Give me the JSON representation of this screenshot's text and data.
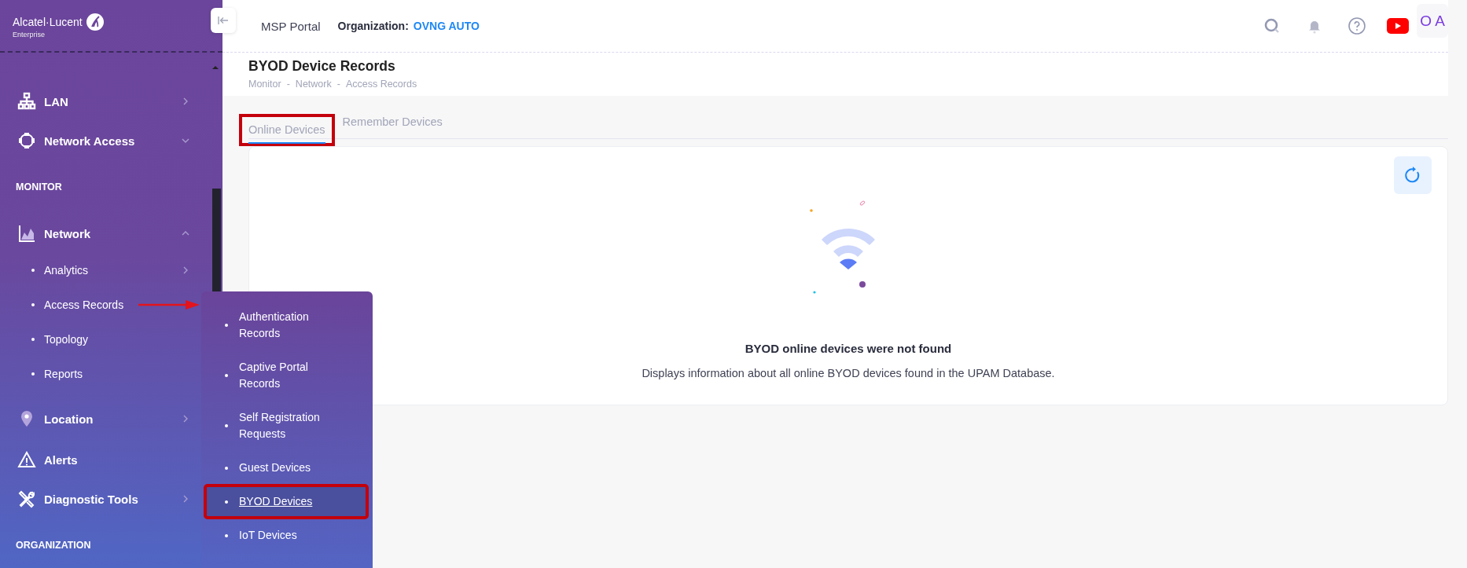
{
  "sidebar": {
    "logo": {
      "name": "Alcatel·Lucent",
      "sub": "Enterprise"
    },
    "items": [
      {
        "kind": "item",
        "label": "LAN",
        "has_submenu": true
      },
      {
        "kind": "item",
        "label": "Network Access",
        "expanded": false
      },
      {
        "kind": "section",
        "label": "MONITOR"
      },
      {
        "kind": "item",
        "label": "Network",
        "expanded": true,
        "children": [
          {
            "label": "Analytics",
            "has_submenu": true
          },
          {
            "label": "Access Records",
            "pointed": true
          },
          {
            "label": "Topology"
          },
          {
            "label": "Reports"
          }
        ]
      },
      {
        "kind": "item",
        "label": "Location",
        "has_submenu": true
      },
      {
        "kind": "item",
        "label": "Alerts"
      },
      {
        "kind": "item",
        "label": "Diagnostic Tools",
        "has_submenu": true
      },
      {
        "kind": "section",
        "label": "ORGANIZATION"
      }
    ]
  },
  "flyout": [
    {
      "label": "Authentication Records",
      "selected": false,
      "highlighted": false
    },
    {
      "label": "Captive Portal Records",
      "selected": false,
      "highlighted": false
    },
    {
      "label": "Self Registration Requests",
      "selected": false,
      "highlighted": false
    },
    {
      "label": "Guest Devices",
      "selected": false,
      "highlighted": false
    },
    {
      "label": "BYOD Devices",
      "selected": true,
      "highlighted": true
    },
    {
      "label": "IoT Devices",
      "selected": false,
      "highlighted": false
    }
  ],
  "header": {
    "portal": "MSP Portal",
    "org_label": "Organization:",
    "org_value": "OVNG AUTO",
    "avatar": "O A"
  },
  "page": {
    "title": "BYOD Device Records",
    "breadcrumb": [
      "Monitor",
      "Network",
      "Access Records"
    ],
    "breadcrumb_separator": "-"
  },
  "tabs": [
    {
      "label": "Online Devices",
      "selected": true,
      "highlighted": true
    },
    {
      "label": "Remember Devices",
      "selected": false
    }
  ],
  "empty_state": {
    "title": "BYOD online devices were not found",
    "description": "Displays information about all online BYOD devices found in the UPAM Database."
  }
}
